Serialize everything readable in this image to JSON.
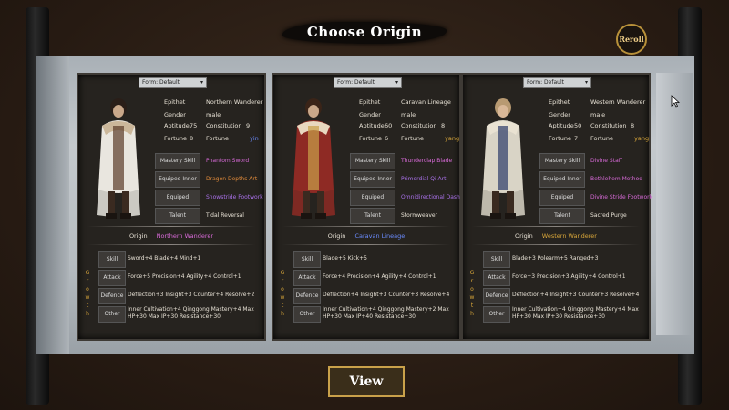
{
  "title": "Choose Origin",
  "reroll_label": "Reroll",
  "view_label": "View",
  "panels": [
    {
      "form": "Form: Default",
      "epithet_label": "Epithet",
      "epithet": "Northern Wanderer",
      "gender_label": "Gender",
      "gender": "male",
      "aptitude_label": "Aptitude",
      "aptitude": "75",
      "constitution_label": "Constitution",
      "constitution": "9",
      "fortune_label": "Fortune",
      "fortune": "8",
      "fortune2_label": "Fortune",
      "fortune2": "yin",
      "mastery_label": "Mastery Skill",
      "mastery": "Phantom Sword",
      "inner_label": "Equiped Inner",
      "inner": "Dragon Depths Art",
      "footwork_label": "Equiped Footwork",
      "footwork": "Snowstride Footwork",
      "talent_label": "Talent",
      "talent": "Tidal Reversal",
      "origin_label": "Origin",
      "origin": "Northern Wanderer",
      "skill_label": "Skill",
      "skill_text": "Sword+4 Blade+4 Mind+1",
      "attack_label": "Attack",
      "attack_text": "Force+5 Precision+4 Agility+4 Control+1",
      "defence_label": "Defence",
      "defence_text": "Deflection+3 Insight+3 Counter+4 Resolve+2",
      "other_label": "Other",
      "other_line1": "Inner Cultivation+4 Qinggong Mastery+4 Max",
      "other_line2": "HP+30 Max IP+30 Resistance+30",
      "colors": {
        "mastery": "#d86ad8",
        "inner": "#e08a3a",
        "footwork": "#a870e8",
        "fortune2": "#6b8cff",
        "origin": "#d86ad8"
      }
    },
    {
      "form": "Form: Default",
      "epithet_label": "Epithet",
      "epithet": "Caravan Lineage",
      "gender_label": "Gender",
      "gender": "male",
      "aptitude_label": "Aptitude",
      "aptitude": "60",
      "constitution_label": "Constitution",
      "constitution": "8",
      "fortune_label": "Fortune",
      "fortune": "6",
      "fortune2_label": "Fortune",
      "fortune2": "yang",
      "mastery_label": "Mastery Skill",
      "mastery": "Thunderclap Blade",
      "inner_label": "Equiped Inner",
      "inner": "Primordial Qi Art",
      "footwork_label": "Equiped Footwork",
      "footwork": "Omnidirectional Dash",
      "talent_label": "Talent",
      "talent": "Stormweaver",
      "origin_label": "Origin",
      "origin": "Caravan Lineage",
      "skill_label": "Skill",
      "skill_text": "Blade+5 Kick+5",
      "attack_label": "Attack",
      "attack_text": "Force+4 Precision+4 Agility+4 Control+1",
      "defence_label": "Defence",
      "defence_text": "Deflection+4 Insight+3 Counter+3 Resolve+4",
      "other_label": "Other",
      "other_line1": "Inner Cultivation+4 Qinggong Mastery+2 Max",
      "other_line2": "HP+30 Max IP+40 Resistance+30",
      "colors": {
        "mastery": "#d86ad8",
        "inner": "#a870e8",
        "footwork": "#a870e8",
        "fortune2": "#d8a63a",
        "origin": "#6b8cff"
      }
    },
    {
      "form": "Form: Default",
      "epithet_label": "Epithet",
      "epithet": "Western Wanderer",
      "gender_label": "Gender",
      "gender": "male",
      "aptitude_label": "Aptitude",
      "aptitude": "50",
      "constitution_label": "Constitution",
      "constitution": "8",
      "fortune_label": "Fortune",
      "fortune": "7",
      "fortune2_label": "Fortune",
      "fortune2": "yang",
      "mastery_label": "Mastery Skill",
      "mastery": "Divine Staff",
      "inner_label": "Equiped Inner",
      "inner": "Bethlehem Method",
      "footwork_label": "Equiped Footwork",
      "footwork": "Divine Stride Footwork",
      "talent_label": "Talent",
      "talent": "Sacred Purge",
      "origin_label": "Origin",
      "origin": "Western Wanderer",
      "skill_label": "Skill",
      "skill_text": "Blade+3 Polearm+5 Ranged+3",
      "attack_label": "Attack",
      "attack_text": "Force+3 Precision+3 Agility+4 Control+1",
      "defence_label": "Defence",
      "defence_text": "Deflection+4 Insight+3 Counter+3 Resolve+4",
      "other_label": "Other",
      "other_line1": "Inner Cultivation+4 Qinggong Mastery+4 Max",
      "other_line2": "HP+30 Max IP+30 Resistance+30",
      "colors": {
        "mastery": "#d86ad8",
        "inner": "#d86ad8",
        "footwork": "#d86ad8",
        "fortune2": "#d8a63a",
        "origin": "#d8a63a"
      }
    }
  ],
  "growth_letters": [
    "G",
    "r",
    "o",
    "w",
    "t",
    "h"
  ]
}
